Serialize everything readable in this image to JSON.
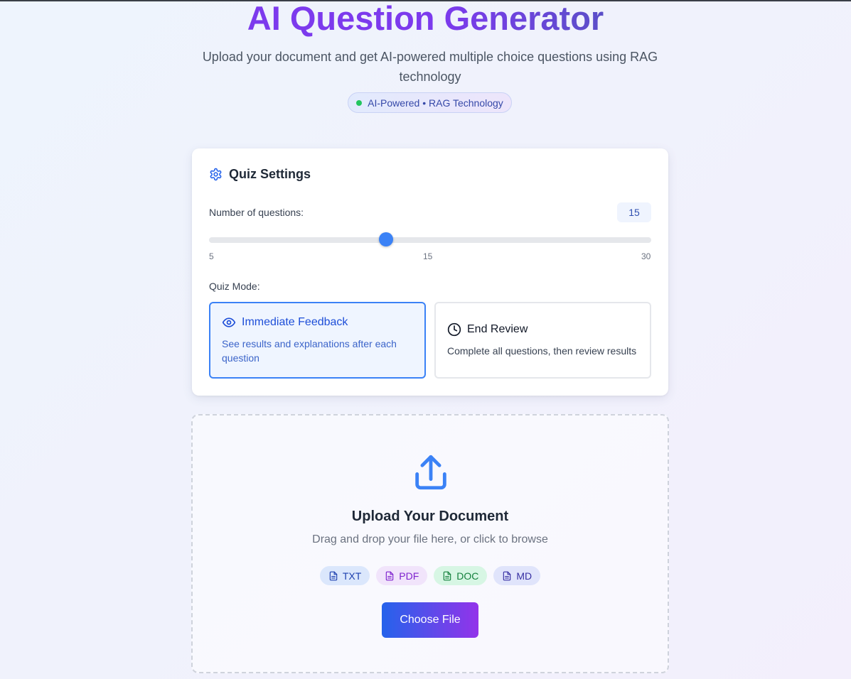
{
  "header": {
    "title": "AI Question Generator",
    "subtitle": "Upload your document and get AI-powered multiple choice questions using RAG technology",
    "badge": "AI-Powered • RAG Technology"
  },
  "settings": {
    "title": "Quiz Settings",
    "num_label": "Number of questions:",
    "num_value": 15,
    "slider": {
      "min": 5,
      "max": 30,
      "value": 15
    },
    "ticks": [
      "5",
      "15",
      "30"
    ],
    "mode_label": "Quiz Mode:",
    "modes": [
      {
        "name": "Immediate Feedback",
        "desc": "See results and explanations after each question",
        "selected": true,
        "icon": "eye-icon"
      },
      {
        "name": "End Review",
        "desc": "Complete all questions, then review results",
        "selected": false,
        "icon": "clock-icon"
      }
    ]
  },
  "upload": {
    "title": "Upload Your Document",
    "hint": "Drag and drop your file here, or click to browse",
    "formats": [
      "TXT",
      "PDF",
      "DOC",
      "MD"
    ],
    "button": "Choose File"
  },
  "colors": {
    "accent": "#3b82f6",
    "title_gradient_start": "#7c3aed",
    "button_gradient_start": "#2563eb",
    "button_gradient_end": "#9333ea",
    "status_dot": "#22c55e"
  }
}
